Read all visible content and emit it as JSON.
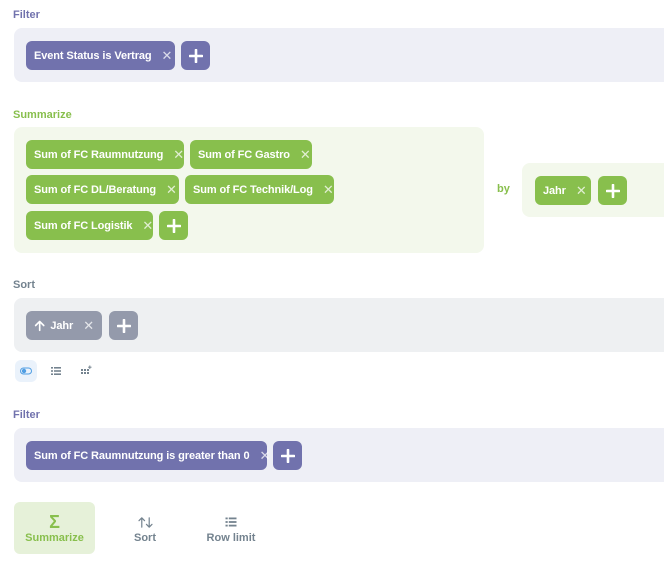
{
  "filter1": {
    "label": "Filter",
    "pills": [
      {
        "label": "Event Status is Vertrag"
      }
    ]
  },
  "summarize": {
    "label": "Summarize",
    "metrics": [
      {
        "label": "Sum of FC Raumnutzung"
      },
      {
        "label": "Sum of FC Gastro"
      },
      {
        "label": "Sum of FC DL/Beratung"
      },
      {
        "label": "Sum of FC Technik/Log"
      },
      {
        "label": "Sum of FC Logistik"
      }
    ],
    "by_label": "by",
    "breakouts": [
      {
        "label": "Jahr"
      }
    ]
  },
  "sort": {
    "label": "Sort",
    "pills": [
      {
        "label": "Jahr",
        "direction": "ascending"
      }
    ]
  },
  "filter2": {
    "label": "Filter",
    "pills": [
      {
        "label": "Sum of FC Raumnutzung is greater than 0"
      }
    ]
  },
  "action_buttons": [
    {
      "label": "Summarize",
      "icon": "sigma-icon",
      "active": true
    },
    {
      "label": "Sort",
      "icon": "sort-arrows-icon"
    },
    {
      "label": "Row limit",
      "icon": "list-icon"
    }
  ],
  "colors": {
    "filter": "#7172ad",
    "summarize": "#88bf4d",
    "sort": "#949aab"
  }
}
